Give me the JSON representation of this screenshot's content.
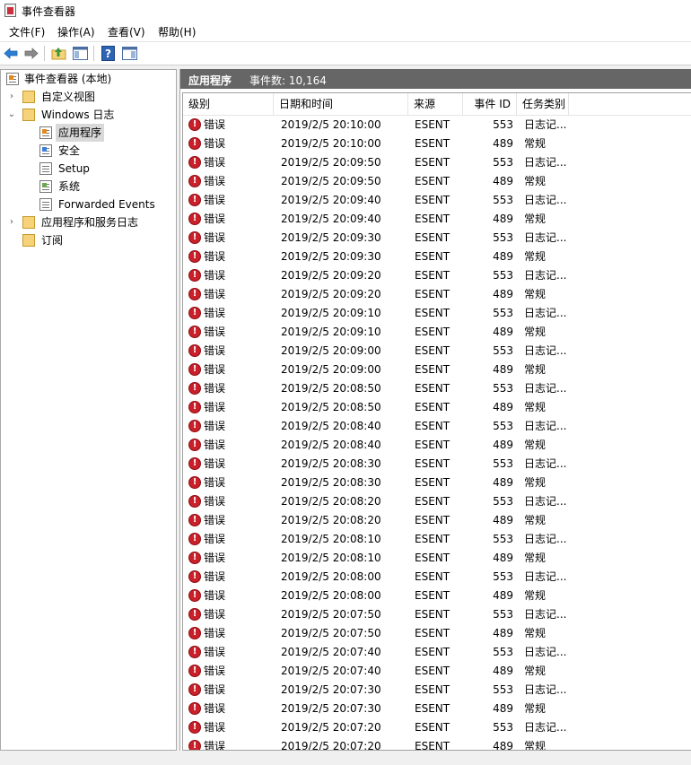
{
  "window": {
    "title": "事件查看器"
  },
  "menu": [
    "文件(F)",
    "操作(A)",
    "查看(V)",
    "帮助(H)"
  ],
  "tree": {
    "root": "事件查看器 (本地)",
    "custom_views": "自定义视图",
    "windows_logs": "Windows 日志",
    "application": "应用程序",
    "security": "安全",
    "setup": "Setup",
    "system": "系统",
    "forwarded": "Forwarded Events",
    "app_service_logs": "应用程序和服务日志",
    "subscriptions": "订阅"
  },
  "pane": {
    "title": "应用程序",
    "count_label": "事件数: 10,164"
  },
  "columns": {
    "level": "级别",
    "datetime": "日期和时间",
    "source": "来源",
    "event_id": "事件 ID",
    "category": "任务类别"
  },
  "events": [
    {
      "level": "错误",
      "datetime": "2019/2/5 20:10:00",
      "source": "ESENT",
      "id": "553",
      "category": "日志记..."
    },
    {
      "level": "错误",
      "datetime": "2019/2/5 20:10:00",
      "source": "ESENT",
      "id": "489",
      "category": "常规"
    },
    {
      "level": "错误",
      "datetime": "2019/2/5 20:09:50",
      "source": "ESENT",
      "id": "553",
      "category": "日志记..."
    },
    {
      "level": "错误",
      "datetime": "2019/2/5 20:09:50",
      "source": "ESENT",
      "id": "489",
      "category": "常规"
    },
    {
      "level": "错误",
      "datetime": "2019/2/5 20:09:40",
      "source": "ESENT",
      "id": "553",
      "category": "日志记..."
    },
    {
      "level": "错误",
      "datetime": "2019/2/5 20:09:40",
      "source": "ESENT",
      "id": "489",
      "category": "常规"
    },
    {
      "level": "错误",
      "datetime": "2019/2/5 20:09:30",
      "source": "ESENT",
      "id": "553",
      "category": "日志记..."
    },
    {
      "level": "错误",
      "datetime": "2019/2/5 20:09:30",
      "source": "ESENT",
      "id": "489",
      "category": "常规"
    },
    {
      "level": "错误",
      "datetime": "2019/2/5 20:09:20",
      "source": "ESENT",
      "id": "553",
      "category": "日志记..."
    },
    {
      "level": "错误",
      "datetime": "2019/2/5 20:09:20",
      "source": "ESENT",
      "id": "489",
      "category": "常规"
    },
    {
      "level": "错误",
      "datetime": "2019/2/5 20:09:10",
      "source": "ESENT",
      "id": "553",
      "category": "日志记..."
    },
    {
      "level": "错误",
      "datetime": "2019/2/5 20:09:10",
      "source": "ESENT",
      "id": "489",
      "category": "常规"
    },
    {
      "level": "错误",
      "datetime": "2019/2/5 20:09:00",
      "source": "ESENT",
      "id": "553",
      "category": "日志记..."
    },
    {
      "level": "错误",
      "datetime": "2019/2/5 20:09:00",
      "source": "ESENT",
      "id": "489",
      "category": "常规"
    },
    {
      "level": "错误",
      "datetime": "2019/2/5 20:08:50",
      "source": "ESENT",
      "id": "553",
      "category": "日志记..."
    },
    {
      "level": "错误",
      "datetime": "2019/2/5 20:08:50",
      "source": "ESENT",
      "id": "489",
      "category": "常规"
    },
    {
      "level": "错误",
      "datetime": "2019/2/5 20:08:40",
      "source": "ESENT",
      "id": "553",
      "category": "日志记..."
    },
    {
      "level": "错误",
      "datetime": "2019/2/5 20:08:40",
      "source": "ESENT",
      "id": "489",
      "category": "常规"
    },
    {
      "level": "错误",
      "datetime": "2019/2/5 20:08:30",
      "source": "ESENT",
      "id": "553",
      "category": "日志记..."
    },
    {
      "level": "错误",
      "datetime": "2019/2/5 20:08:30",
      "source": "ESENT",
      "id": "489",
      "category": "常规"
    },
    {
      "level": "错误",
      "datetime": "2019/2/5 20:08:20",
      "source": "ESENT",
      "id": "553",
      "category": "日志记..."
    },
    {
      "level": "错误",
      "datetime": "2019/2/5 20:08:20",
      "source": "ESENT",
      "id": "489",
      "category": "常规"
    },
    {
      "level": "错误",
      "datetime": "2019/2/5 20:08:10",
      "source": "ESENT",
      "id": "553",
      "category": "日志记..."
    },
    {
      "level": "错误",
      "datetime": "2019/2/5 20:08:10",
      "source": "ESENT",
      "id": "489",
      "category": "常规"
    },
    {
      "level": "错误",
      "datetime": "2019/2/5 20:08:00",
      "source": "ESENT",
      "id": "553",
      "category": "日志记..."
    },
    {
      "level": "错误",
      "datetime": "2019/2/5 20:08:00",
      "source": "ESENT",
      "id": "489",
      "category": "常规"
    },
    {
      "level": "错误",
      "datetime": "2019/2/5 20:07:50",
      "source": "ESENT",
      "id": "553",
      "category": "日志记..."
    },
    {
      "level": "错误",
      "datetime": "2019/2/5 20:07:50",
      "source": "ESENT",
      "id": "489",
      "category": "常规"
    },
    {
      "level": "错误",
      "datetime": "2019/2/5 20:07:40",
      "source": "ESENT",
      "id": "553",
      "category": "日志记..."
    },
    {
      "level": "错误",
      "datetime": "2019/2/5 20:07:40",
      "source": "ESENT",
      "id": "489",
      "category": "常规"
    },
    {
      "level": "错误",
      "datetime": "2019/2/5 20:07:30",
      "source": "ESENT",
      "id": "553",
      "category": "日志记..."
    },
    {
      "level": "错误",
      "datetime": "2019/2/5 20:07:30",
      "source": "ESENT",
      "id": "489",
      "category": "常规"
    },
    {
      "level": "错误",
      "datetime": "2019/2/5 20:07:20",
      "source": "ESENT",
      "id": "553",
      "category": "日志记..."
    },
    {
      "level": "错误",
      "datetime": "2019/2/5 20:07:20",
      "source": "ESENT",
      "id": "489",
      "category": "常规"
    }
  ],
  "colors": {
    "pane_header": "#666666",
    "error": "#c9202a",
    "nav_arrow": "#2a7fd4",
    "selected": "#d9d9d9"
  }
}
